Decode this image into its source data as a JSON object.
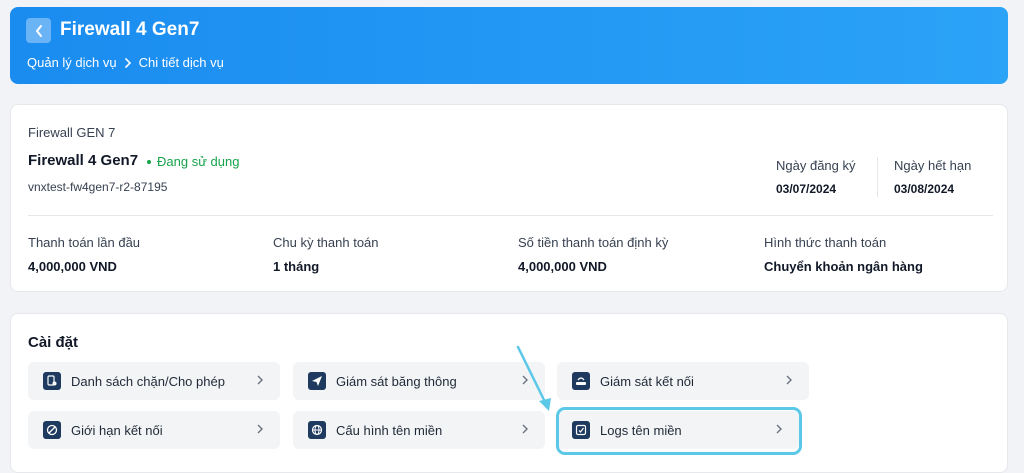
{
  "header": {
    "title": "Firewall 4 Gen7",
    "breadcrumb": [
      "Quản lý dịch vụ",
      "Chi tiết dịch vụ"
    ]
  },
  "service": {
    "plan": "Firewall GEN 7",
    "name": "Firewall 4 Gen7",
    "status": "Đang sử dụng",
    "id": "vnxtest-fw4gen7-r2-87195",
    "register_label": "Ngày đăng ký",
    "register_date": "03/07/2024",
    "expire_label": "Ngày hết hạn",
    "expire_date": "03/08/2024"
  },
  "payment": [
    {
      "label": "Thanh toán lần đầu",
      "value": "4,000,000 VND"
    },
    {
      "label": "Chu kỳ thanh toán",
      "value": "1 tháng"
    },
    {
      "label": "Số tiền thanh toán định kỳ",
      "value": "4,000,000 VND"
    },
    {
      "label": "Hình thức thanh toán",
      "value": "Chuyển khoản ngân hàng"
    }
  ],
  "settings": {
    "title": "Cài đặt",
    "items": [
      {
        "label": "Danh sách chặn/Cho phép",
        "icon": "document-shield-icon"
      },
      {
        "label": "Giám sát băng thông",
        "icon": "send-icon"
      },
      {
        "label": "Giám sát kết nối",
        "icon": "router-icon"
      },
      {
        "label": "Giới hạn kết nối",
        "icon": "block-icon"
      },
      {
        "label": "Cấu hình tên miền",
        "icon": "globe-icon"
      },
      {
        "label": "Logs tên miền",
        "icon": "log-icon"
      }
    ]
  },
  "colors": {
    "header_start": "#1a8cf0",
    "header_end": "#2ba3f7",
    "status": "#16a34a",
    "icon_bg": "#1e3a5f",
    "highlight": "#5bc8e8"
  }
}
